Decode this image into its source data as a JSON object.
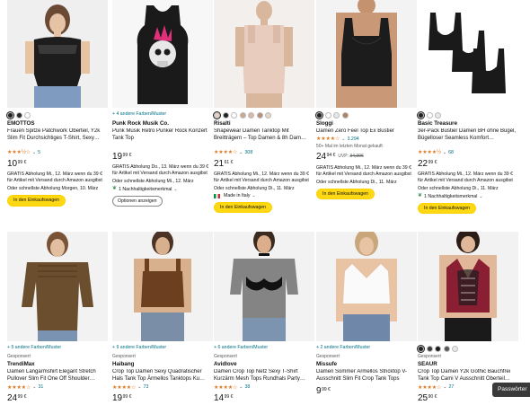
{
  "colors": {
    "star": "#de7921",
    "link": "#007185",
    "cart_button": "#ffd814"
  },
  "products": [
    {
      "brand": "EMOTTOS",
      "title": "Frauen Spitze Patchwork Oberteil, Y2k Slim Fit Durchsichtiges T-Shirt, Sexy…",
      "stars": "★★★½☆",
      "rating_count": "5",
      "price_int": "10",
      "price_frac": "99 €",
      "shipping_line1": "GRATIS Abholung Mi., 12. März wenn du 39 € für Artikel mit Versand durch Amazon ausgibst",
      "shipping_line2": "Oder schnellste Abholung Morgen, 10. März",
      "cart_label": "In den Einkaufswagen",
      "swatches": [
        "#222222",
        "#2a2a2a",
        "#ffffff"
      ]
    },
    {
      "more_colors": "+ 4 andere Farben/Muster",
      "brand": "Punk Rock Musik Co.",
      "title": "Punk Musik Retro Punker Rock Konzert Tank Top",
      "price_int": "19",
      "price_frac": "99 €",
      "shipping_line1": "GRATIS Abholung Do., 13. März wenn du 39 € für Artikel mit Versand durch Amazon ausgibst",
      "shipping_line2": "Oder schnellste Abholung Mi., 12. März",
      "sustain": "1 Nachhaltigkeitsmerkmal",
      "options_label": "Optionen anzeigen"
    },
    {
      "brand": "Risalti",
      "title": "Shapewear Damen Tanktop Mit Breitträgern – Top Damen & 8h Dam…",
      "stars": "★★★★☆",
      "rating_count": "308",
      "price_int": "21",
      "price_frac": "61 €",
      "shipping_line1": "GRATIS Abholung Mi., 12. März wenn du 39 € für Artikel mit Versand durch Amazon ausgibst",
      "shipping_line2": "Oder schnellste Abholung Di., 11. März",
      "made_in": "Made in Italy",
      "cart_label": "In den Einkaufswagen",
      "swatches": [
        "#e8cfc6",
        "#222222",
        "#ffffff",
        "#c9a890",
        "#d9b8a5",
        "#b88f78",
        "#e6d5c8"
      ]
    },
    {
      "brand": "Sloggi",
      "title": "Damen Zero Feel Top Ex Bustier",
      "stars": "★★★★☆",
      "rating_count": "3.294",
      "bought": "50+ Mal im letzten Monat gekauft",
      "price_int": "24",
      "price_frac": "94 €",
      "uvp_label": "UVP:",
      "uvp_value": "34,00€",
      "shipping_line1": "GRATIS Abholung Mi., 12. März wenn du 39 € für Artikel mit Versand durch Amazon ausgibst",
      "shipping_line2": "Oder schnellste Abholung Di., 11. März",
      "cart_label": "In den Einkaufswagen",
      "swatches": [
        "#222222",
        "#ffffff",
        "#e7e7e7",
        "#b08060"
      ]
    },
    {
      "brand": "Basic Treasure",
      "title": "3er-Pack Bustier Damen BH ohne Bügel, Bügelloser Seamless Komfort…",
      "stars": "★★★★½",
      "rating_count": "68",
      "price_int": "22",
      "price_frac": "99 €",
      "shipping_line1": "GRATIS Abholung Mi., 12. März wenn du 39 € für Artikel mit Versand durch Amazon ausgibst",
      "shipping_line2": "Oder schnellste Abholung Di., 11. März",
      "sustain": "1 Nachhaltigkeitsmerkmal",
      "cart_label": "In den Einkaufswagen",
      "swatches": [
        "#222222",
        "#ffffff",
        "#e8e8e8"
      ]
    },
    {
      "more_colors": "+ 5 andere Farben/Muster",
      "sponsored": "Gesponsert",
      "brand": "TrendiMax",
      "title": "Damen Langarmshirt Elegant Stretch Pullover Slim Fit One Off Shoulder…",
      "stars": "★★★★☆",
      "rating_count": "31",
      "price_int": "24",
      "price_frac": "99 €"
    },
    {
      "more_colors": "+ 9 andere Farben/Muster",
      "sponsored": "Gesponsert",
      "brand": "Haibang",
      "title": "Crop Top Damen Sexy Quadratischer Hals Tank Top Ärmellos Tanktops Ku…",
      "stars": "★★★★☆",
      "rating_count": "73",
      "price_int": "19",
      "price_frac": "99 €"
    },
    {
      "more_colors": "+ 6 andere Farben/Muster",
      "sponsored": "Gesponsert",
      "brand": "Avidlove",
      "title": "Damen Crop Top Netz Sexy T-Shirt Kurzärm Mesh Tops Rundhals Party…",
      "stars": "★★★★☆",
      "rating_count": "38",
      "price_int": "14",
      "price_frac": "99 €"
    },
    {
      "more_colors": "+ 2 andere Farben/Muster",
      "sponsored": "Gesponsert",
      "brand": "Missufe",
      "title": "Damen Sommer Ärmellos Stricktop V-Ausschnitt Slim Fit Crop Tank Tops",
      "price_int": "9",
      "price_frac": "99 €"
    },
    {
      "sponsored": "Gesponsert",
      "brand": "SEAUR",
      "title": "Crop Top Damen Y2k Gothic Bauchfrei Tank Top Cami V Ausschnitt Oberteil…",
      "stars": "★★★★☆",
      "rating_count": "27",
      "price_int": "25",
      "price_frac": "90 €",
      "swatches": [
        "#222222",
        "#3a3a3a",
        "#1a1a1a",
        "#555555",
        "#e8e8e8"
      ]
    }
  ],
  "tooltip": "Passwörter"
}
